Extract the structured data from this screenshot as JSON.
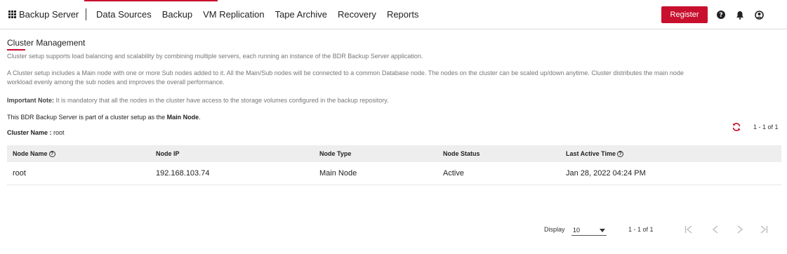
{
  "header": {
    "brand": "Backup Server",
    "nav": [
      "Data Sources",
      "Backup",
      "VM Replication",
      "Tape Archive",
      "Recovery",
      "Reports"
    ],
    "register_label": "Register",
    "accent_color": "#c8102e"
  },
  "page": {
    "title": "Cluster Management",
    "intro": "Cluster setup supports load balancing and scalability by combining multiple servers, each running an instance of the BDR Backup Server application.",
    "desc_line1": "A Cluster setup includes a Main node with one or more Sub nodes added to it. All the Main/Sub nodes will be connected to a common Database node. The nodes on the cluster can be scaled up/down anytime. Cluster distributes the main node",
    "desc_line2": "workload evenly among the sub nodes and improves the overall performance.",
    "note_label": "Important Note:",
    "note_text": " It is mandatory that all the nodes in the cluster have access to the storage volumes configured in the backup repository.",
    "status_prefix": "This BDR Backup Server is part of a cluster setup as the ",
    "status_role": "Main Node",
    "status_suffix": ".",
    "cluster_name_label": "Cluster Name :",
    "cluster_name_value": " root",
    "range_top": "1 - 1 of 1"
  },
  "table": {
    "columns": [
      "Node Name",
      "Node IP",
      "Node Type",
      "Node Status",
      "Last Active Time"
    ],
    "rows": [
      {
        "name": "root",
        "ip": "192.168.103.74",
        "type": "Main Node",
        "status": "Active",
        "last_active": "Jan 28, 2022 04:24 PM"
      }
    ]
  },
  "pagination": {
    "display_label": "Display",
    "page_size": "10",
    "range": "1 - 1 of 1"
  },
  "icons": {
    "apps": "grid-icon",
    "help": "question-circle-icon",
    "notifications": "bell-icon",
    "account": "user-circle-icon",
    "refresh": "refresh-icon"
  }
}
